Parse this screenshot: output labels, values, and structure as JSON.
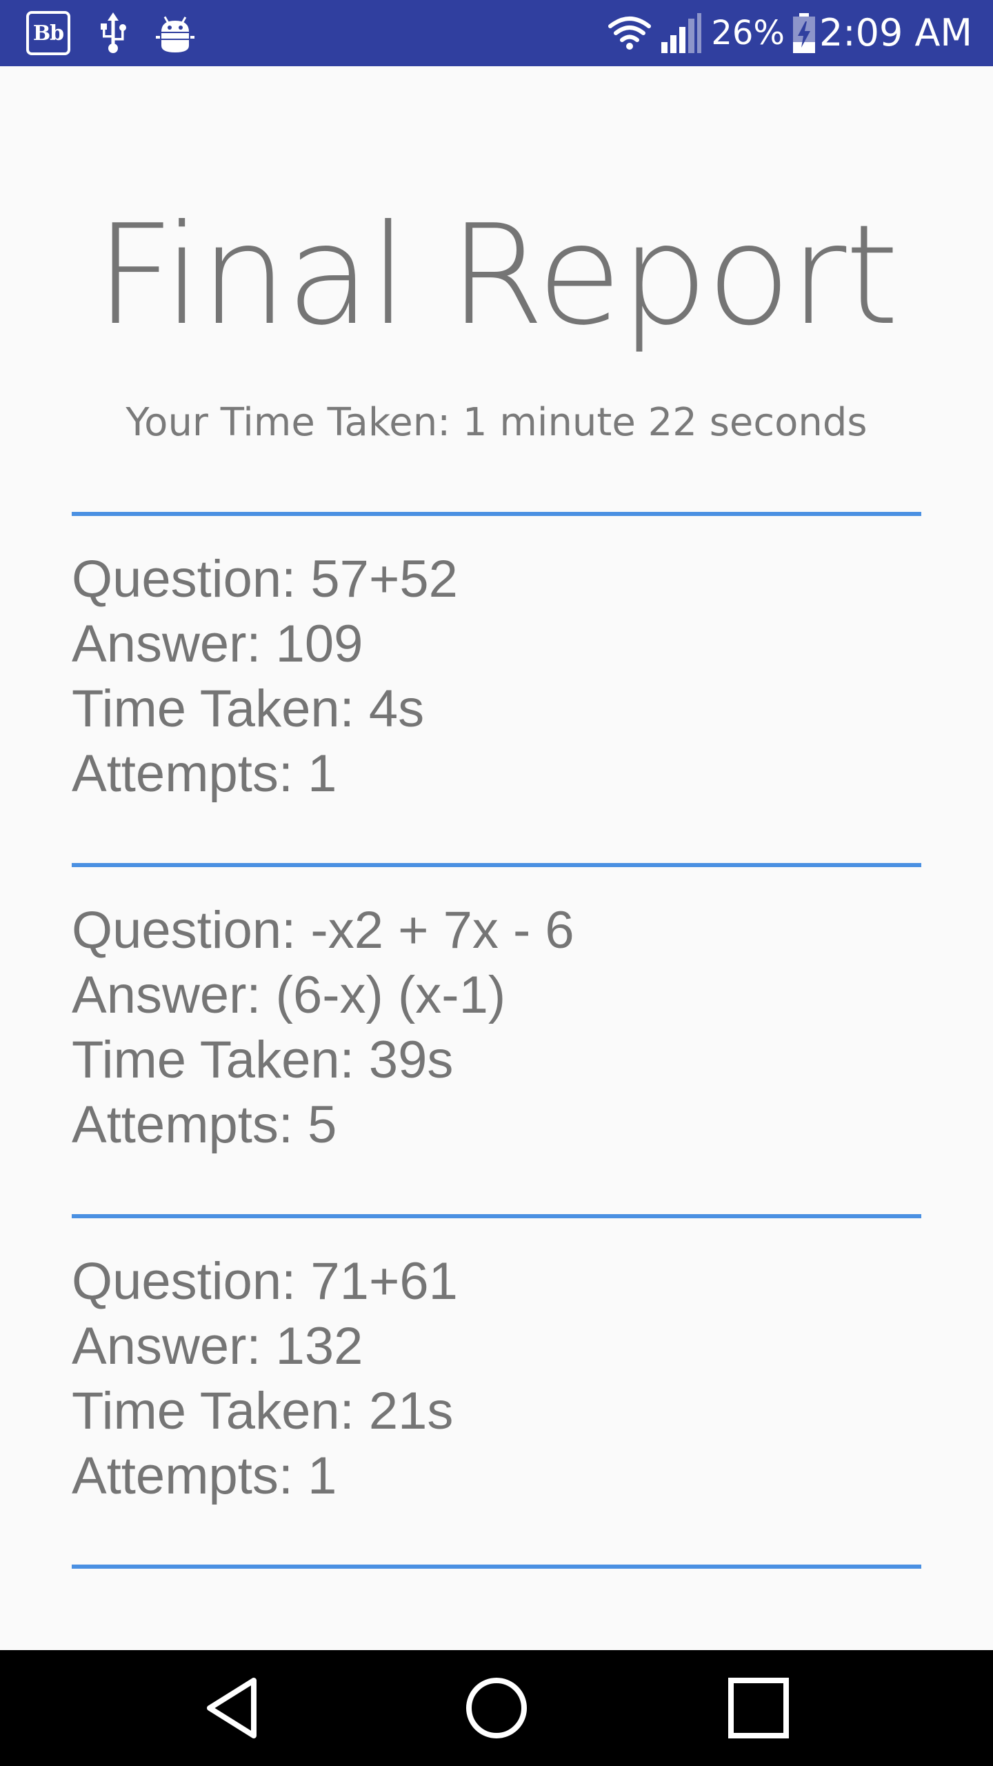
{
  "status_bar": {
    "app_badge": "Bb",
    "icons": [
      "blackboard-icon",
      "usb-icon",
      "android-debug-icon",
      "wifi-icon",
      "cell-signal-icon",
      "battery-charging-icon"
    ],
    "battery_percent": "26%",
    "time": "2:09 AM",
    "background_color": "#303f9f"
  },
  "report": {
    "title": "Final Report",
    "total_time": "Your Time Taken: 1 minute 22 seconds",
    "divider_color": "#4a90e2",
    "items": [
      {
        "question": "Question: 57+52",
        "answer": "Answer: 109",
        "time_taken": "Time Taken: 4s",
        "attempts": "Attempts: 1"
      },
      {
        "question": "Question: -x2 + 7x - 6",
        "answer": "Answer: (6-x) (x-1)",
        "time_taken": "Time Taken: 39s",
        "attempts": "Attempts: 5"
      },
      {
        "question": "Question: 71+61",
        "answer": "Answer: 132",
        "time_taken": "Time Taken: 21s",
        "attempts": "Attempts: 1"
      }
    ]
  },
  "nav_bar": {
    "buttons": [
      "back-icon",
      "home-icon",
      "recents-icon"
    ]
  }
}
